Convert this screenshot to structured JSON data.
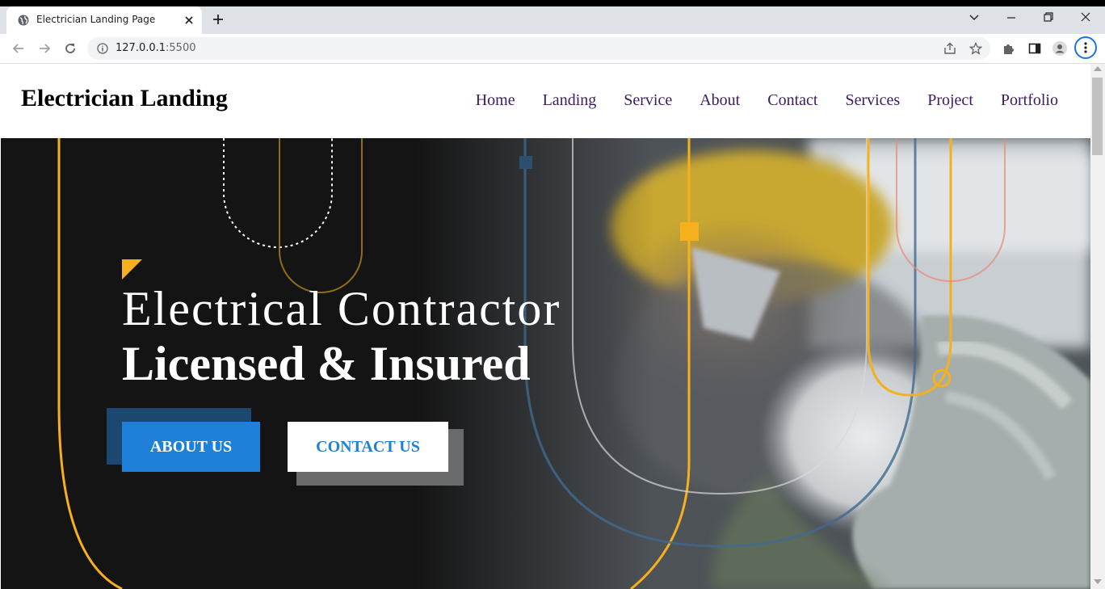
{
  "browser": {
    "tab_title": "Electrician Landing Page",
    "url_host": "127.0.0.1",
    "url_port": ":5500"
  },
  "site": {
    "logo": "Electrician Landing",
    "nav": [
      "Home",
      "Landing",
      "Service",
      "About",
      "Contact",
      "Services",
      "Project",
      "Portfolio"
    ]
  },
  "hero": {
    "line1": "Electrical Contractor",
    "line2": "Licensed & Insured",
    "about_button": "ABOUT US",
    "contact_button": "CONTACT US"
  },
  "colors": {
    "accent_yellow": "#f6b01e",
    "primary_blue": "#1e80d8",
    "nav_purple": "#3d1a63"
  }
}
